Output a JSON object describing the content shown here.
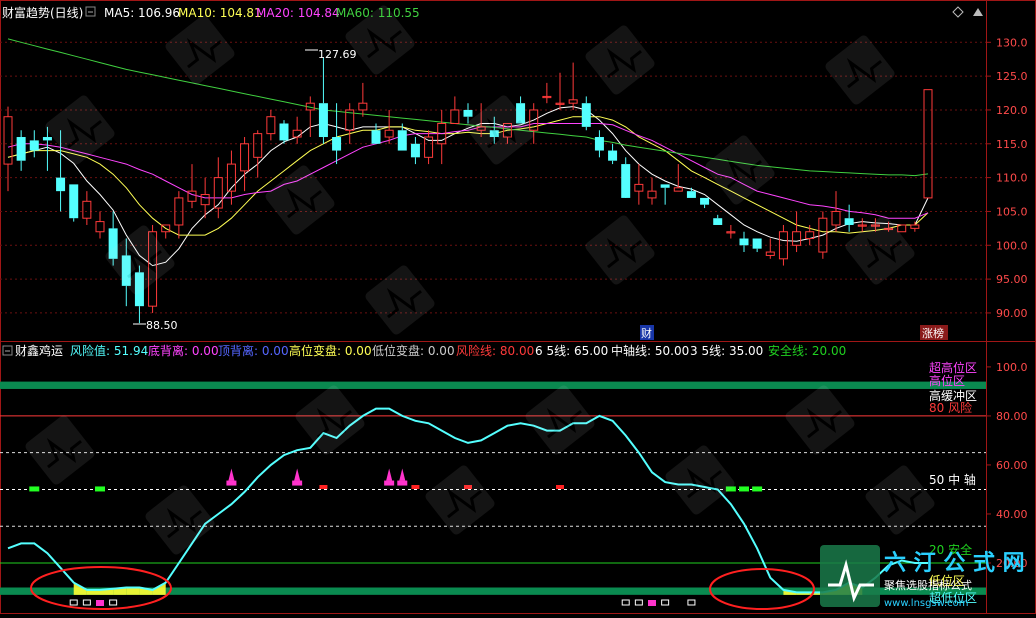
{
  "colors": {
    "background": "#000000",
    "frame": "#a01616",
    "grid": "#6a1010",
    "up": "#ff3a3a",
    "down": "#54ffff",
    "ma5": "#ffffff",
    "ma10": "#ffff55",
    "ma20": "#ff44ff",
    "ma60": "#40d040",
    "risk_line": "#ff3a3a",
    "safe_line": "#20d020",
    "band": "#0a8a50",
    "flag_purple": "#ff33cc",
    "flag_red": "#ff2222",
    "flag_green": "#22ff22"
  },
  "top_header": {
    "title": "财富趋势(日线)",
    "ma": [
      {
        "label": "MA5: 106.96",
        "color": "#ffffff"
      },
      {
        "label": "MA10: 104.81",
        "color": "#ffff55"
      },
      {
        "label": "MA20: 104.84",
        "color": "#ff44ff"
      },
      {
        "label": "MA60: 110.55",
        "color": "#40d040"
      }
    ]
  },
  "bottom_header": {
    "title": "财鑫鸡运",
    "items": [
      {
        "label": "风险值: 51.94",
        "color": "#54ffff"
      },
      {
        "label": "底背离: 0.00",
        "color": "#ff44ff"
      },
      {
        "label": "顶背离: 0.00",
        "color": "#5566ff"
      },
      {
        "label": "高位变盘: 0.00",
        "color": "#ffff55"
      },
      {
        "label": "低位变盘: 0.00",
        "color": "#cccccc"
      },
      {
        "label": "风险线: 80.00",
        "color": "#ff3a3a"
      },
      {
        "label": "6 5线: 65.00",
        "color": "#ffffff"
      },
      {
        "label": "中轴线: 50.00",
        "color": "#ffffff"
      },
      {
        "label": "3 5线: 35.00",
        "color": "#ffffff"
      },
      {
        "label": "安全线: 20.00",
        "color": "#20d020"
      }
    ]
  },
  "markers": {
    "high_price": "127.69",
    "low_price": "88.50",
    "cai_tag": "财",
    "zhangbang_tag": "涨榜"
  },
  "zone_labels": [
    {
      "text": "超高位区",
      "value": 98,
      "color": "#ff44ff"
    },
    {
      "text": "高位区",
      "value": 95,
      "color": "#ff44ff"
    },
    {
      "text": "高缓冲区",
      "value": 85,
      "color": "#ffffff"
    },
    {
      "text": "80 风险",
      "value": 81,
      "color": "#ff3a3a"
    },
    {
      "text": "50 中 轴",
      "value": 51,
      "color": "#ffffff"
    },
    {
      "text": "20 安全",
      "value": 21,
      "color": "#20d020"
    },
    {
      "text": "低位区",
      "value": 12,
      "color": "#ffff55"
    },
    {
      "text": "超低位区",
      "value": 5,
      "color": "#54ffff"
    }
  ],
  "chart_data": [
    {
      "type": "candlestick",
      "title": "财富趋势(日线)",
      "ylim": [
        86,
        133
      ],
      "yticks": [
        90,
        95,
        100,
        105,
        110,
        115,
        120,
        125,
        130
      ],
      "ytick_labels": [
        "90.00",
        "95.00",
        "100.0",
        "105.0",
        "110.0",
        "115.0",
        "120.0",
        "125.0",
        "130.0"
      ],
      "candles": [
        [
          112,
          120.5,
          108,
          119
        ],
        [
          116,
          117,
          111,
          112.5
        ],
        [
          115.5,
          117,
          113,
          114
        ],
        [
          116,
          117.5,
          111,
          115.5
        ],
        [
          110,
          117,
          105,
          108
        ],
        [
          109,
          109,
          103.5,
          104
        ],
        [
          104,
          108,
          103,
          106.5
        ],
        [
          102,
          105,
          101,
          103.5
        ],
        [
          102.5,
          105,
          97,
          98
        ],
        [
          98.5,
          101,
          91,
          94
        ],
        [
          96,
          97,
          88.5,
          91
        ],
        [
          91,
          103,
          90,
          102
        ],
        [
          102,
          103,
          101,
          103
        ],
        [
          103,
          108,
          101,
          107
        ],
        [
          106.5,
          112,
          105.5,
          108
        ],
        [
          106,
          110,
          104,
          107.5
        ],
        [
          105.5,
          113,
          104,
          110
        ],
        [
          108,
          114,
          106,
          112
        ],
        [
          111,
          116,
          108,
          115
        ],
        [
          113,
          117,
          110,
          116.5
        ],
        [
          116.5,
          120,
          115.5,
          119
        ],
        [
          118,
          118.5,
          115,
          115.5
        ],
        [
          116,
          119,
          115,
          117
        ],
        [
          120,
          122,
          116,
          121
        ],
        [
          121,
          127.69,
          115,
          116
        ],
        [
          116,
          121,
          112,
          114
        ],
        [
          117,
          121,
          115,
          120
        ],
        [
          120,
          124,
          119,
          121
        ],
        [
          117,
          118,
          115,
          115
        ],
        [
          116,
          120,
          115,
          117
        ],
        [
          117,
          118,
          114,
          114
        ],
        [
          115,
          116,
          112,
          113
        ],
        [
          113,
          117,
          112,
          116
        ],
        [
          115,
          120,
          112,
          118
        ],
        [
          118,
          122,
          118,
          120
        ],
        [
          120,
          121,
          118,
          119
        ],
        [
          117,
          121,
          116,
          117.5
        ],
        [
          117,
          119,
          115,
          116
        ],
        [
          116,
          118,
          115,
          118
        ],
        [
          121,
          122,
          118,
          118
        ],
        [
          117,
          121,
          115,
          120
        ],
        [
          122,
          124,
          121,
          122
        ],
        [
          121,
          125.5,
          120,
          121
        ],
        [
          121,
          127,
          120,
          121.5
        ],
        [
          121,
          122,
          117,
          117.5
        ],
        [
          116,
          117,
          113,
          114
        ],
        [
          114,
          115,
          112,
          112.5
        ],
        [
          112,
          113,
          108,
          107
        ],
        [
          108,
          112,
          106,
          109
        ],
        [
          107,
          110,
          106,
          108
        ],
        [
          109,
          109,
          106,
          108.5
        ],
        [
          108,
          112,
          108,
          108.5
        ],
        [
          108,
          108.5,
          107,
          107
        ],
        [
          107,
          107,
          105.5,
          106
        ],
        [
          104,
          104.5,
          103,
          103
        ],
        [
          102,
          103,
          101,
          102
        ],
        [
          101,
          102,
          99,
          100
        ],
        [
          101,
          101,
          99,
          99.5
        ],
        [
          98.5,
          101,
          98,
          99
        ],
        [
          98,
          103,
          97,
          102
        ],
        [
          100,
          105,
          99,
          102
        ],
        [
          101,
          103,
          100,
          102
        ],
        [
          99,
          105,
          98,
          104
        ],
        [
          103,
          108,
          102,
          105
        ],
        [
          104,
          106,
          102,
          103
        ],
        [
          103,
          104,
          102,
          103
        ],
        [
          103,
          104,
          102,
          103
        ],
        [
          102.5,
          103.5,
          102,
          102.5
        ],
        [
          102,
          103,
          102,
          103
        ],
        [
          102.5,
          103.5,
          102,
          103
        ],
        [
          107,
          123,
          107,
          123
        ]
      ],
      "series": [
        {
          "name": "MA5",
          "values": [
            113,
            113.5,
            114,
            114.5,
            113.6,
            112.1,
            109.5,
            107.5,
            105.2,
            101.5,
            98.5,
            97,
            97.5,
            99.5,
            102.5,
            104.5,
            106,
            108.5,
            110.5,
            112,
            114,
            115.3,
            116,
            117.5,
            118,
            117.5,
            117,
            117.5,
            117.5,
            117.5,
            117.5,
            116.5,
            115.5,
            115.5,
            116.5,
            117.3,
            118,
            118,
            117.5,
            117.8,
            118.5,
            119.5,
            120.3,
            120.5,
            120,
            118.5,
            116.5,
            114,
            112,
            110.5,
            109.5,
            108.7,
            108.3,
            107.5,
            106,
            104.5,
            103,
            102,
            101.2,
            100.7,
            100.6,
            101,
            101.5,
            102.5,
            103.2,
            103.5,
            103.3,
            103.2,
            103,
            103,
            107
          ]
        },
        {
          "name": "MA10",
          "values": [
            113,
            113.5,
            114,
            114,
            114,
            113.5,
            113,
            112,
            110.5,
            108.5,
            106,
            104,
            102.5,
            101.5,
            101.5,
            101.5,
            102.5,
            104,
            106,
            108,
            109.5,
            111,
            112.5,
            114,
            115,
            116,
            116.5,
            117,
            117,
            117.5,
            117.5,
            117,
            116.8,
            116.5,
            116.5,
            116.7,
            116.5,
            116.5,
            117,
            117.2,
            117.5,
            118,
            118.5,
            119,
            119,
            119,
            118.5,
            117.5,
            116,
            115,
            114,
            112.5,
            111,
            110,
            109,
            108,
            107,
            106,
            105,
            104,
            103,
            102.5,
            102,
            102,
            101.8,
            102,
            102.2,
            102.5,
            103,
            103,
            104.8
          ]
        },
        {
          "name": "MA20",
          "values": [
            114.5,
            115,
            115,
            114.8,
            114.5,
            114,
            113.5,
            113,
            112.5,
            112,
            111.2,
            110.5,
            109.5,
            108.5,
            107.5,
            107,
            107,
            107,
            107.5,
            107.8,
            108,
            109,
            109.5,
            110.5,
            111.5,
            112.5,
            113.5,
            114.5,
            115,
            115.5,
            116.2,
            116.5,
            116.5,
            116.5,
            116.8,
            117,
            117.5,
            117.5,
            117.5,
            117.5,
            118,
            118,
            118,
            118,
            118,
            118,
            117.8,
            117,
            116.2,
            115.5,
            114.5,
            113.5,
            112.5,
            111.5,
            110.5,
            110,
            109,
            108,
            107.5,
            107,
            106.5,
            106,
            105.8,
            105.5,
            105,
            104.8,
            104.5,
            104,
            104,
            104,
            104.8
          ]
        },
        {
          "name": "MA60",
          "values": [
            130.5,
            130,
            129.5,
            129,
            128.5,
            128,
            127.5,
            127,
            126.5,
            126,
            125.6,
            125.2,
            124.8,
            124.4,
            124,
            123.6,
            123.2,
            122.8,
            122.4,
            122,
            121.6,
            121.2,
            120.8,
            120.4,
            120,
            119.8,
            119.6,
            119.4,
            119.2,
            119,
            118.8,
            118.6,
            118.4,
            118.2,
            118,
            117.8,
            117.6,
            117.4,
            117.2,
            117,
            116.8,
            116.6,
            116.4,
            116.2,
            116,
            115.5,
            115.2,
            114.8,
            114.5,
            114.2,
            113.9,
            113.6,
            113.3,
            113,
            112.7,
            112.4,
            112.1,
            111.8,
            111.6,
            111.4,
            111.2,
            111,
            110.9,
            110.8,
            110.7,
            110.6,
            110.5,
            110.4,
            110.4,
            110.3,
            110.55
          ]
        }
      ]
    },
    {
      "type": "line",
      "title": "财鑫鸡运",
      "ylim": [
        0,
        102
      ],
      "yticks": [
        20,
        40,
        60,
        80,
        100
      ],
      "ytick_labels": [
        "20.00",
        "40.00",
        "60.00",
        "80.00",
        "100.0"
      ],
      "reference_lines": [
        {
          "name": "风险线",
          "value": 80
        },
        {
          "name": "6 5线",
          "value": 65
        },
        {
          "name": "中轴线",
          "value": 50
        },
        {
          "name": "3 5线",
          "value": 35
        },
        {
          "name": "安全线",
          "value": 20
        }
      ],
      "bands": [
        [
          91,
          94
        ],
        [
          7,
          10
        ]
      ],
      "series": [
        {
          "name": "风险值",
          "values": [
            26,
            28,
            28,
            24,
            18,
            12,
            9,
            9,
            9.5,
            10,
            10,
            9,
            12,
            20,
            28,
            36,
            40,
            44,
            49,
            55,
            60,
            64,
            66,
            67,
            73,
            71,
            76,
            80,
            83,
            83,
            80,
            78,
            77,
            74,
            71,
            69,
            70,
            73,
            76,
            77,
            76,
            74,
            74,
            77,
            77,
            80,
            78,
            72,
            65,
            57,
            53,
            52,
            52,
            51,
            50,
            44,
            36,
            26,
            14,
            9,
            8,
            8,
            8,
            9,
            12,
            10,
            14,
            19,
            21,
            20,
            20
          ]
        }
      ],
      "flags": [
        {
          "kind": "green",
          "index": 2,
          "value": 50
        },
        {
          "kind": "green",
          "index": 7,
          "value": 50
        },
        {
          "kind": "purple",
          "index": 17,
          "value": 52
        },
        {
          "kind": "purple",
          "index": 22,
          "value": 52
        },
        {
          "kind": "red",
          "index": 24,
          "value": 51
        },
        {
          "kind": "purple",
          "index": 29,
          "value": 52
        },
        {
          "kind": "purple",
          "index": 30,
          "value": 52
        },
        {
          "kind": "red",
          "index": 31,
          "value": 51
        },
        {
          "kind": "red",
          "index": 35,
          "value": 51
        },
        {
          "kind": "red",
          "index": 42,
          "value": 51
        },
        {
          "kind": "green",
          "index": 55,
          "value": 50
        },
        {
          "kind": "green",
          "index": 56,
          "value": 50
        },
        {
          "kind": "green",
          "index": 57,
          "value": 50
        }
      ],
      "low_markers": [
        {
          "index": 5,
          "kind": "hollow"
        },
        {
          "index": 6,
          "kind": "hollow"
        },
        {
          "index": 7,
          "kind": "filled"
        },
        {
          "index": 8,
          "kind": "hollow"
        },
        {
          "index": 47,
          "kind": "hollow"
        },
        {
          "index": 48,
          "kind": "hollow"
        },
        {
          "index": 49,
          "kind": "filled"
        },
        {
          "index": 50,
          "kind": "hollow"
        },
        {
          "index": 52,
          "kind": "hollow"
        }
      ]
    }
  ],
  "watermarks": [
    {
      "text": "六 汀 公 式 网"
    },
    {
      "text": "聚焦选股指标公式"
    },
    {
      "text": "www.lnsgsw.com"
    }
  ]
}
